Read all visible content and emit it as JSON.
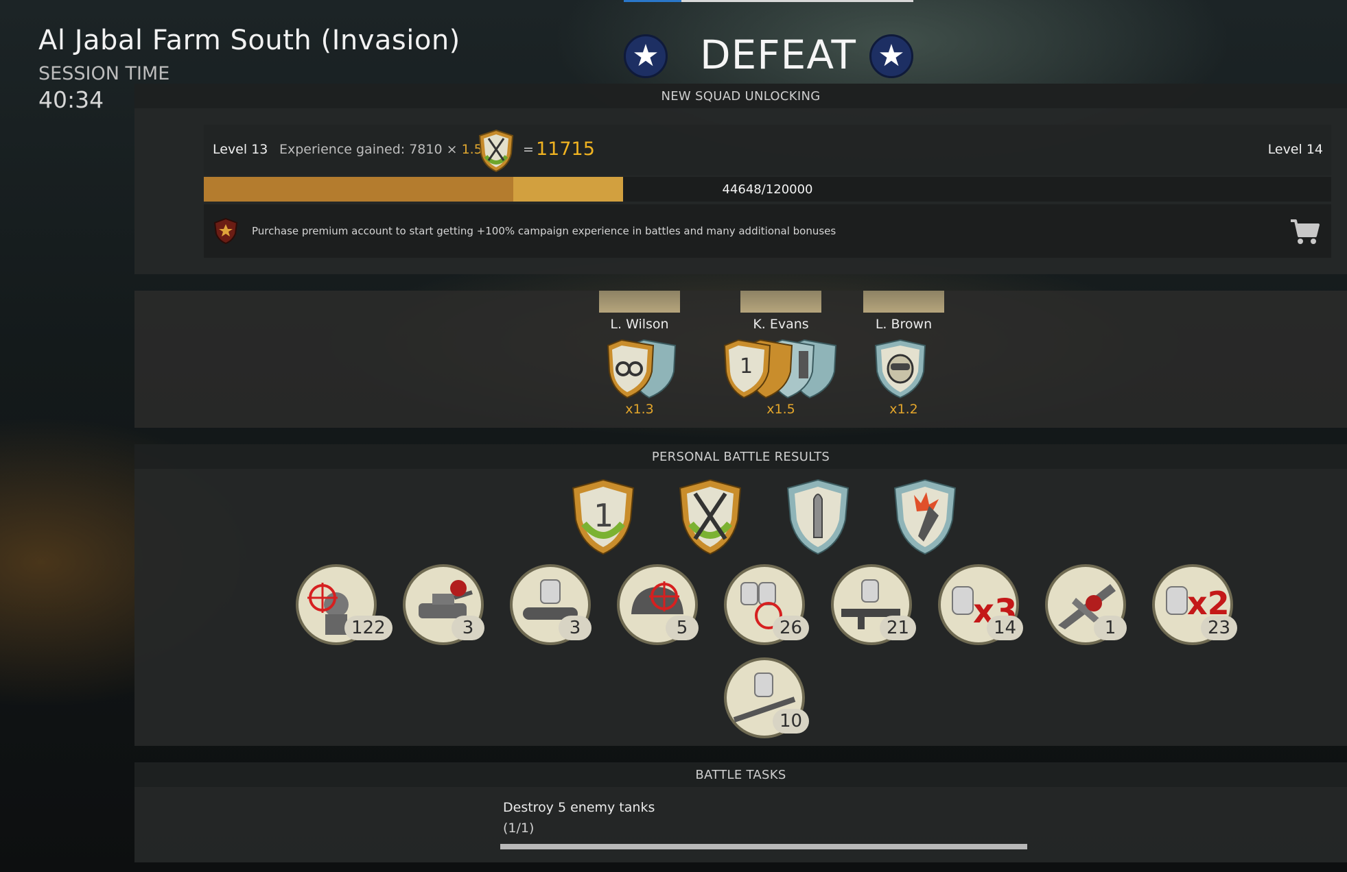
{
  "header": {
    "map_title": "Al Jabal Farm South (Invasion)",
    "session_label": "SESSION TIME",
    "session_time": "40:34",
    "result": "DEFEAT",
    "top_progress_fraction": 0.2
  },
  "squad_unlock": {
    "title": "NEW SQUAD UNLOCKING",
    "level_current": "Level 13",
    "xp_label": "Experience gained: 7810 ×",
    "xp_multiplier": "1.5",
    "eq": "=",
    "xp_total": "11715",
    "level_next": "Level 14",
    "progress_text": "44648/120000",
    "progress_base_fraction": 0.2744,
    "progress_total_fraction": 0.3721,
    "premium_text": "Purchase premium account to start getting +100% campaign experience in battles and many additional bonuses"
  },
  "soldiers": [
    {
      "name": "L. Wilson",
      "multiplier": "x1.3"
    },
    {
      "name": "K. Evans",
      "multiplier": "x1.5"
    },
    {
      "name": "L. Brown",
      "multiplier": "x1.2"
    }
  ],
  "personal_results": {
    "title": "PERSONAL BATTLE RESULTS",
    "medals": [
      {
        "icon": "soldier-target-icon",
        "count": "122"
      },
      {
        "icon": "tank-destroyed-icon",
        "count": "3"
      },
      {
        "icon": "scope-dogtag-icon",
        "count": "3"
      },
      {
        "icon": "helmet-target-icon",
        "count": "5"
      },
      {
        "icon": "dogtags-target-icon",
        "count": "26"
      },
      {
        "icon": "machinegun-dogtag-icon",
        "count": "21"
      },
      {
        "icon": "dogtag-x3-icon",
        "count": "14"
      },
      {
        "icon": "plane-destroyed-icon",
        "count": "1"
      },
      {
        "icon": "dogtag-x2-icon",
        "count": "23"
      },
      {
        "icon": "rifle-dogtag-icon",
        "count": "10"
      }
    ]
  },
  "battle_tasks": {
    "title": "BATTLE TASKS",
    "task_name": "Destroy 5 enemy tanks",
    "task_progress": "(1/1)",
    "task_fraction": 1.0
  },
  "colors": {
    "accent_gold": "#f0b321",
    "xp_bar": "#b47c2e",
    "xp_gain": "#d2a03f",
    "us_blue": "#1d2f63"
  }
}
